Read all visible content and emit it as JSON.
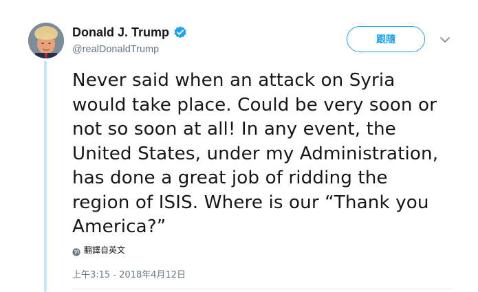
{
  "author": {
    "display_name": "Donald J. Trump",
    "handle": "@realDonaldTrump",
    "verified": true,
    "avatar_icon": "profile-photo"
  },
  "actions": {
    "follow_label": "跟隨",
    "more_icon": "chevron-down-icon"
  },
  "tweet": {
    "text": "Never said when an attack on Syria\nwould take place. Could be very soon or\nnot so soon at all! In any event, the\nUnited States, under my Administration,\nhas done a great job of ridding the\nregion of ISIS. Where is our “Thank you\nAmerica?”",
    "translate_label": "翻譯自英文",
    "timestamp": "上午3:15 - 2018年4月12日"
  },
  "colors": {
    "accent": "#1da1f2",
    "thread_line": "#c4e6fb",
    "secondary_text": "#657786"
  }
}
